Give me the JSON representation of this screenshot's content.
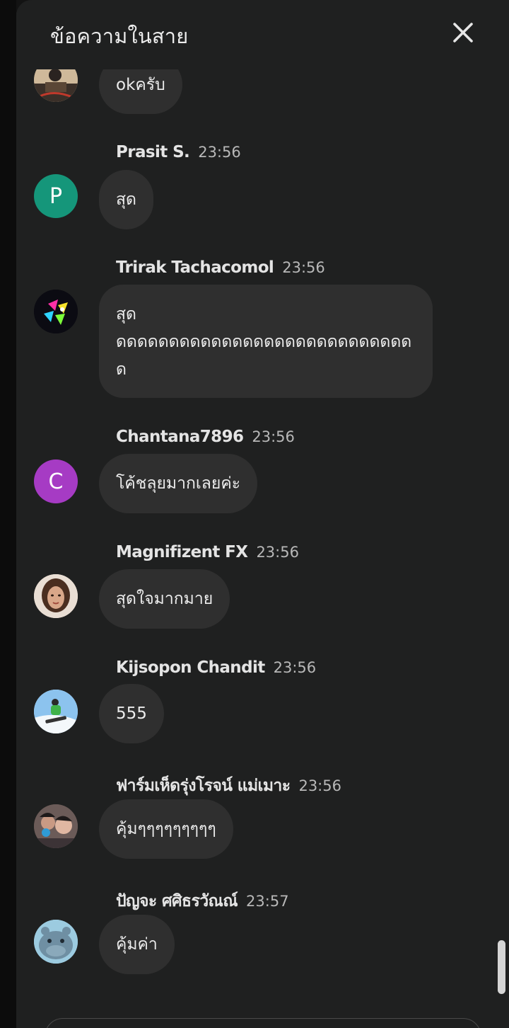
{
  "header": {
    "title": "ข้อความในสาย"
  },
  "messages": [
    {
      "author": "",
      "time": "",
      "text": "okครับ",
      "avatar": {
        "type": "photo",
        "icon": "person-desk-photo-icon"
      }
    },
    {
      "author": "Prasit S.",
      "time": "23:56",
      "text": "สุด",
      "avatar": {
        "type": "initial",
        "initial": "P",
        "color": "#15967a"
      }
    },
    {
      "author": "Trirak Tachacomol",
      "time": "23:56",
      "text": "สุด\nดดดดดดดดดดดดดดดดดดดดดดดดดดดดด",
      "avatar": {
        "type": "photo",
        "icon": "neon-art-avatar-icon"
      }
    },
    {
      "author": "Chantana7896",
      "time": "23:56",
      "text": "โค้ชลุยมากเลยค่ะ",
      "avatar": {
        "type": "initial",
        "initial": "C",
        "color": "#a63bc4"
      }
    },
    {
      "author": "Magnifizent FX",
      "time": "23:56",
      "text": "สุดใจมากมาย",
      "avatar": {
        "type": "photo",
        "icon": "woman-portrait-icon"
      }
    },
    {
      "author": "Kijsopon Chandit",
      "time": "23:56",
      "text": "555",
      "avatar": {
        "type": "photo",
        "icon": "snowboarder-icon"
      }
    },
    {
      "author": "ฟาร์มเห็ดรุ่งโรจน์ แม่เมาะ",
      "time": "23:56",
      "text": "คุ้มๆๆๆๆๆๆๆๆๆ",
      "avatar": {
        "type": "photo",
        "icon": "selfie-people-icon"
      }
    },
    {
      "author": "ปัญจะ ศศิธรวัณณ์",
      "time": "23:57",
      "text": "คุ้มค่า",
      "avatar": {
        "type": "photo",
        "icon": "hippo-icon"
      }
    }
  ]
}
